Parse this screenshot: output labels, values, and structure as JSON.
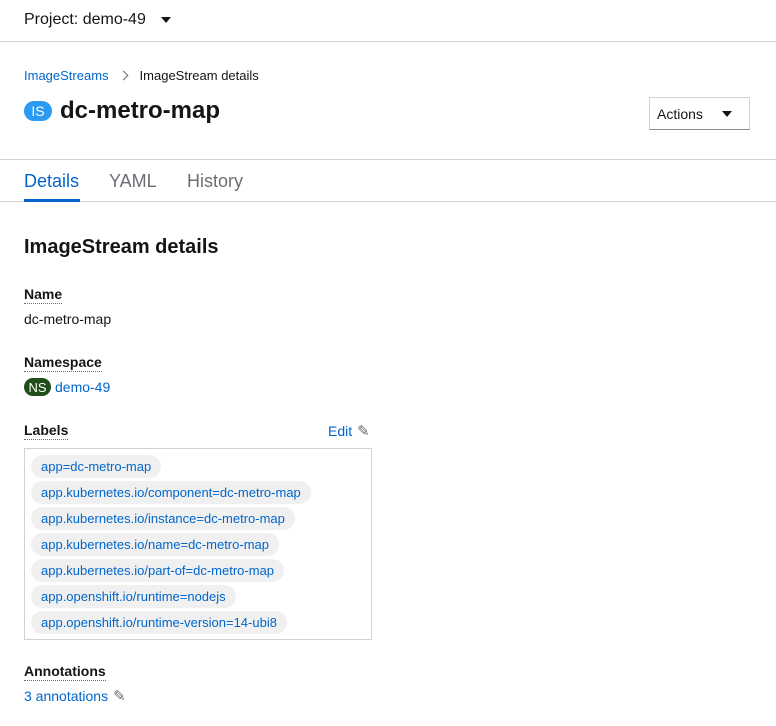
{
  "project": {
    "label": "Project: demo-49"
  },
  "breadcrumb": {
    "parent": "ImageStreams",
    "current": "ImageStream details"
  },
  "header": {
    "badge": "IS",
    "title": "dc-metro-map",
    "actions_label": "Actions"
  },
  "tabs": [
    {
      "label": "Details"
    },
    {
      "label": "YAML"
    },
    {
      "label": "History"
    }
  ],
  "details": {
    "section_title": "ImageStream details",
    "name_label": "Name",
    "name_value": "dc-metro-map",
    "namespace_label": "Namespace",
    "namespace_badge": "NS",
    "namespace_value": "demo-49",
    "labels_label": "Labels",
    "labels_edit": "Edit",
    "labels": [
      "app=dc-metro-map",
      "app.kubernetes.io/component=dc-metro-map",
      "app.kubernetes.io/instance=dc-metro-map",
      "app.kubernetes.io/name=dc-metro-map",
      "app.kubernetes.io/part-of=dc-metro-map",
      "app.openshift.io/runtime=nodejs",
      "app.openshift.io/runtime-version=14-ubi8"
    ],
    "annotations_label": "Annotations",
    "annotations_value": "3 annotations"
  },
  "icons": {
    "pencil": "pencil-icon",
    "caret": "caret-down-icon",
    "breadcrumb_separator": "chevron-right-icon"
  },
  "colors": {
    "link": "#0066cc",
    "is_badge": "#2b9af3",
    "ns_badge": "#1e4f18",
    "chip_bg": "#f0f0f0"
  }
}
